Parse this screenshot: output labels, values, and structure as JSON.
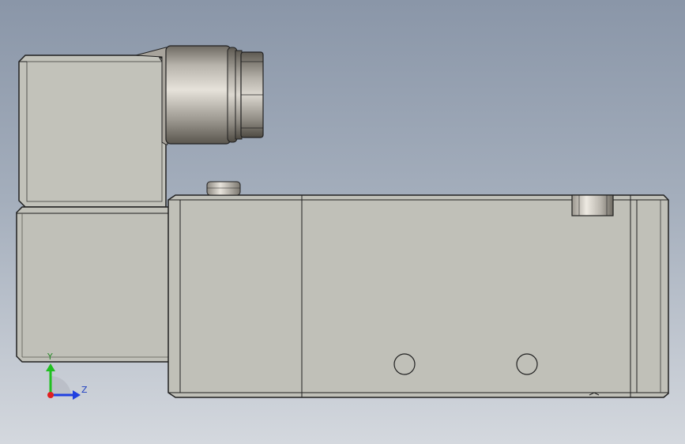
{
  "viewport": {
    "background_top": "#8a96a8",
    "background_bottom": "#d4d8de"
  },
  "model": {
    "body_color": "#c0c0b8",
    "connector_color": "#a8a49c",
    "edge_color": "#202020"
  },
  "triad": {
    "y_label": "Y",
    "z_label": "Z",
    "y_color": "#20c020",
    "z_color": "#2040e0",
    "origin_color": "#e02020"
  }
}
